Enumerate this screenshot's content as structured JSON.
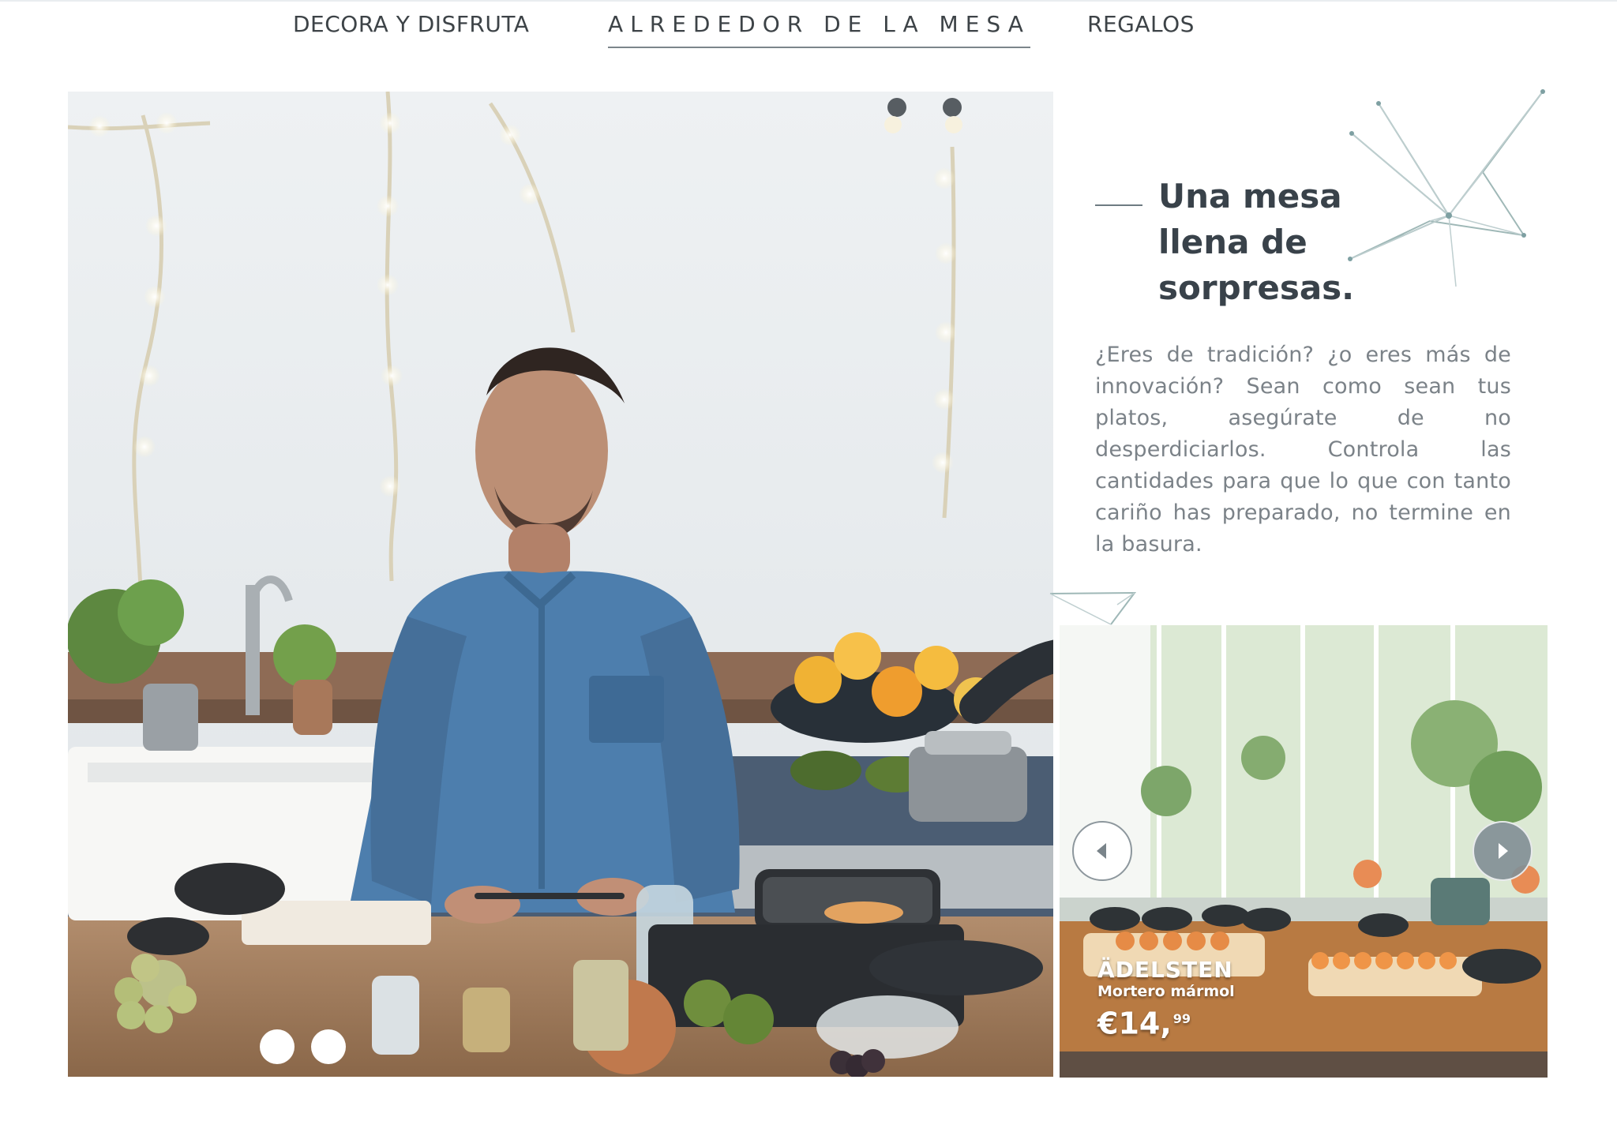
{
  "navigation": {
    "tabs": [
      {
        "label": "DECORA Y DISFRUTA"
      },
      {
        "label": "ALREDEDOR DE LA MESA"
      },
      {
        "label": "REGALOS"
      }
    ]
  },
  "intro": {
    "heading_line_1": "Una mesa",
    "heading_line_2": "llena de sorpresas.",
    "body": "¿Eres de tradición? ¿o eres más de innovación? Sean como sean tus platos, asegúrate de no desperdiciarlos. Controla las cantidades para que lo que con tanto cariño has preparado, no termine en la basura."
  },
  "product_card": {
    "name": "ÄDELSTEN",
    "description": "Mortero mármol",
    "price_main": "€14,",
    "price_cents": "99"
  },
  "icons": {
    "carousel_prev": "arrow-left-icon",
    "carousel_next": "arrow-right-icon"
  },
  "colors": {
    "nav_text": "#3d4347",
    "active_underline": "#7c858b",
    "body_text": "#7b8288",
    "heading": "#39424a",
    "decoration": "#9fb8b7"
  }
}
